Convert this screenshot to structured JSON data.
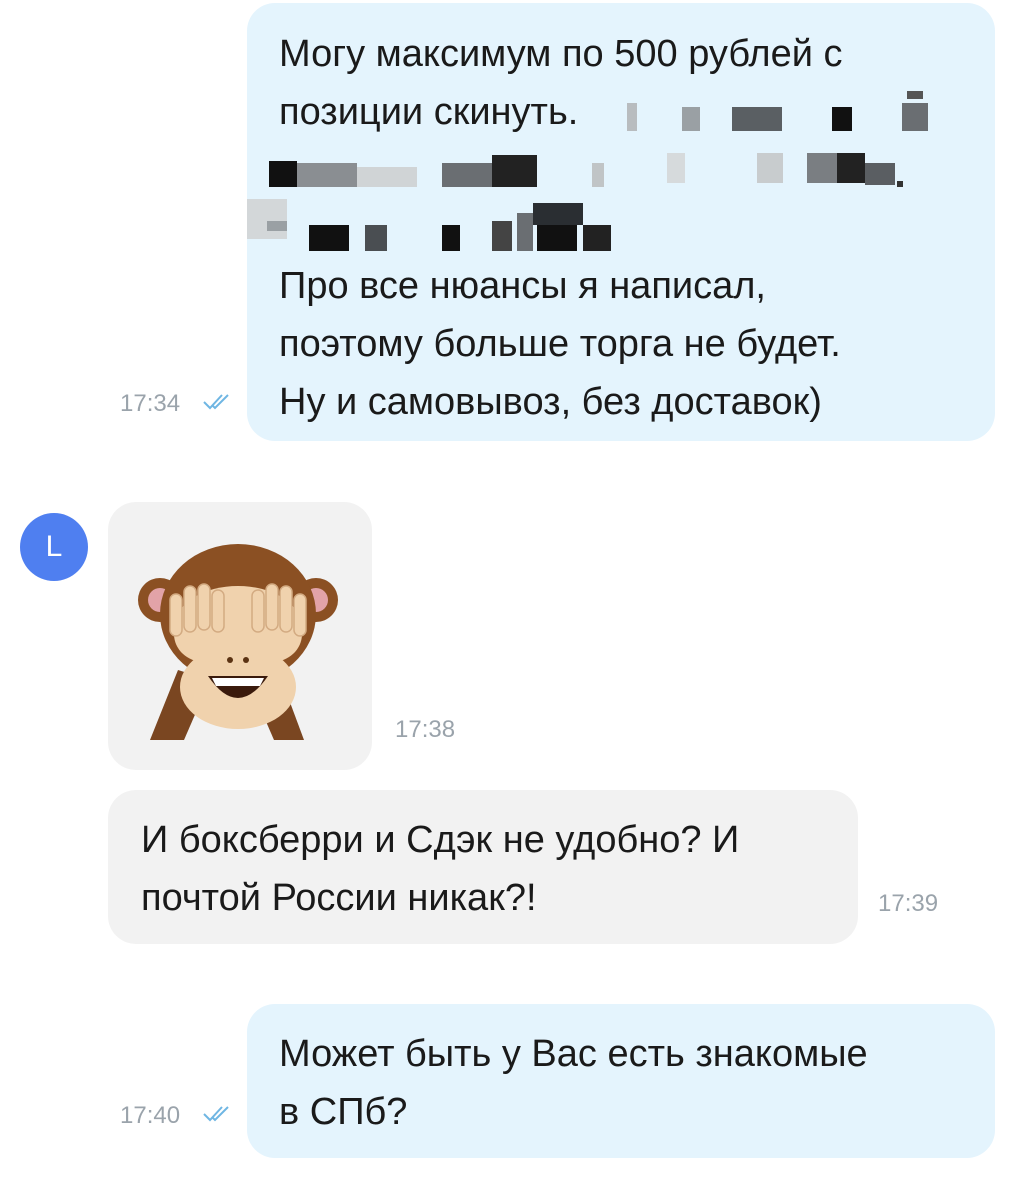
{
  "messages": [
    {
      "side": "outgoing",
      "lines": [
        "Могу максимум по 500 рублей с",
        "позиции скинуть.",
        "",
        "",
        "Про все нюансы я написал,",
        "поэтому больше торга не будет.",
        "Ну и самовывоз, без доставок)"
      ],
      "time": "17:34",
      "status_icon": "double-check-icon"
    },
    {
      "side": "incoming",
      "sender_initial": "L",
      "sticker": "see-no-evil-monkey",
      "time": "17:38"
    },
    {
      "side": "incoming",
      "lines": [
        "И боксберри и Сдэк не удобно? И",
        "почтой России никак?!"
      ],
      "time": "17:39"
    },
    {
      "side": "outgoing",
      "lines": [
        "Может быть у Вас есть знакомые",
        "в СПб?"
      ],
      "time": "17:40",
      "status_icon": "double-check-icon"
    }
  ],
  "colors": {
    "outgoing_bubble": "#e4f4fd",
    "incoming_bubble": "#f2f2f2",
    "avatar": "#4f7ff0",
    "timestamp": "#9aa3ab",
    "read_ticks": "#6fb6e3"
  }
}
